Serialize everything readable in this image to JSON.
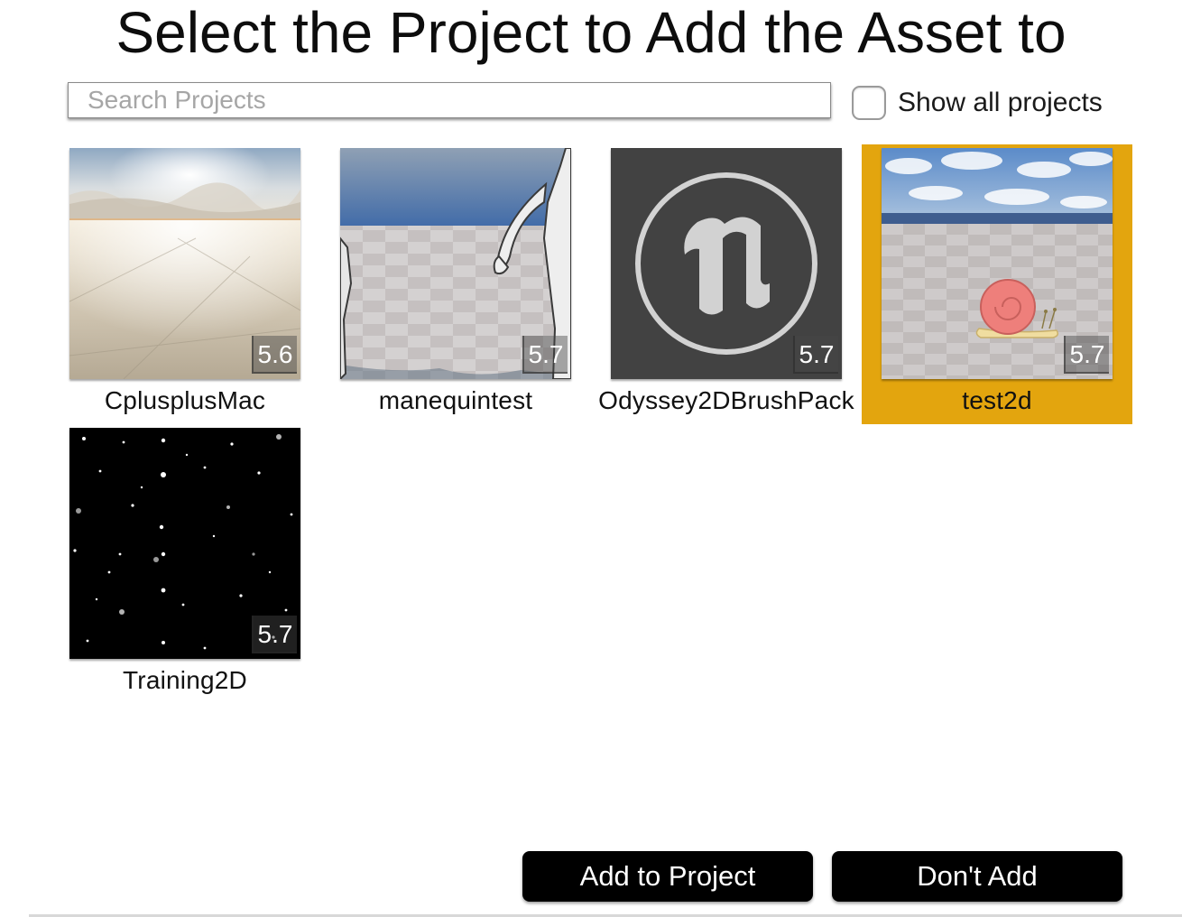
{
  "dialog": {
    "title": "Select the Project to Add the Asset to"
  },
  "search": {
    "value": "",
    "placeholder": "Search Projects"
  },
  "show_all": {
    "label": "Show all projects",
    "checked": false
  },
  "projects": [
    {
      "name": "CplusplusMac",
      "version": "5.6",
      "thumbnail": "desert-sky-thumbnail",
      "selected": false
    },
    {
      "name": "manequintest",
      "version": "5.7",
      "thumbnail": "mannequin-thumbnail",
      "selected": false
    },
    {
      "name": "Odyssey2DBrushPack",
      "version": "5.7",
      "thumbnail": "unreal-logo-thumbnail",
      "selected": false
    },
    {
      "name": "test2d",
      "version": "5.7",
      "thumbnail": "snail-thumbnail",
      "selected": true
    },
    {
      "name": "Training2D",
      "version": "5.7",
      "thumbnail": "starfield-thumbnail",
      "selected": false
    }
  ],
  "buttons": {
    "add_label": "Add to Project",
    "cancel_label": "Don't Add"
  },
  "colors": {
    "selection": "#e3a50e",
    "button_bg": "#000000",
    "button_text": "#ffffff"
  }
}
